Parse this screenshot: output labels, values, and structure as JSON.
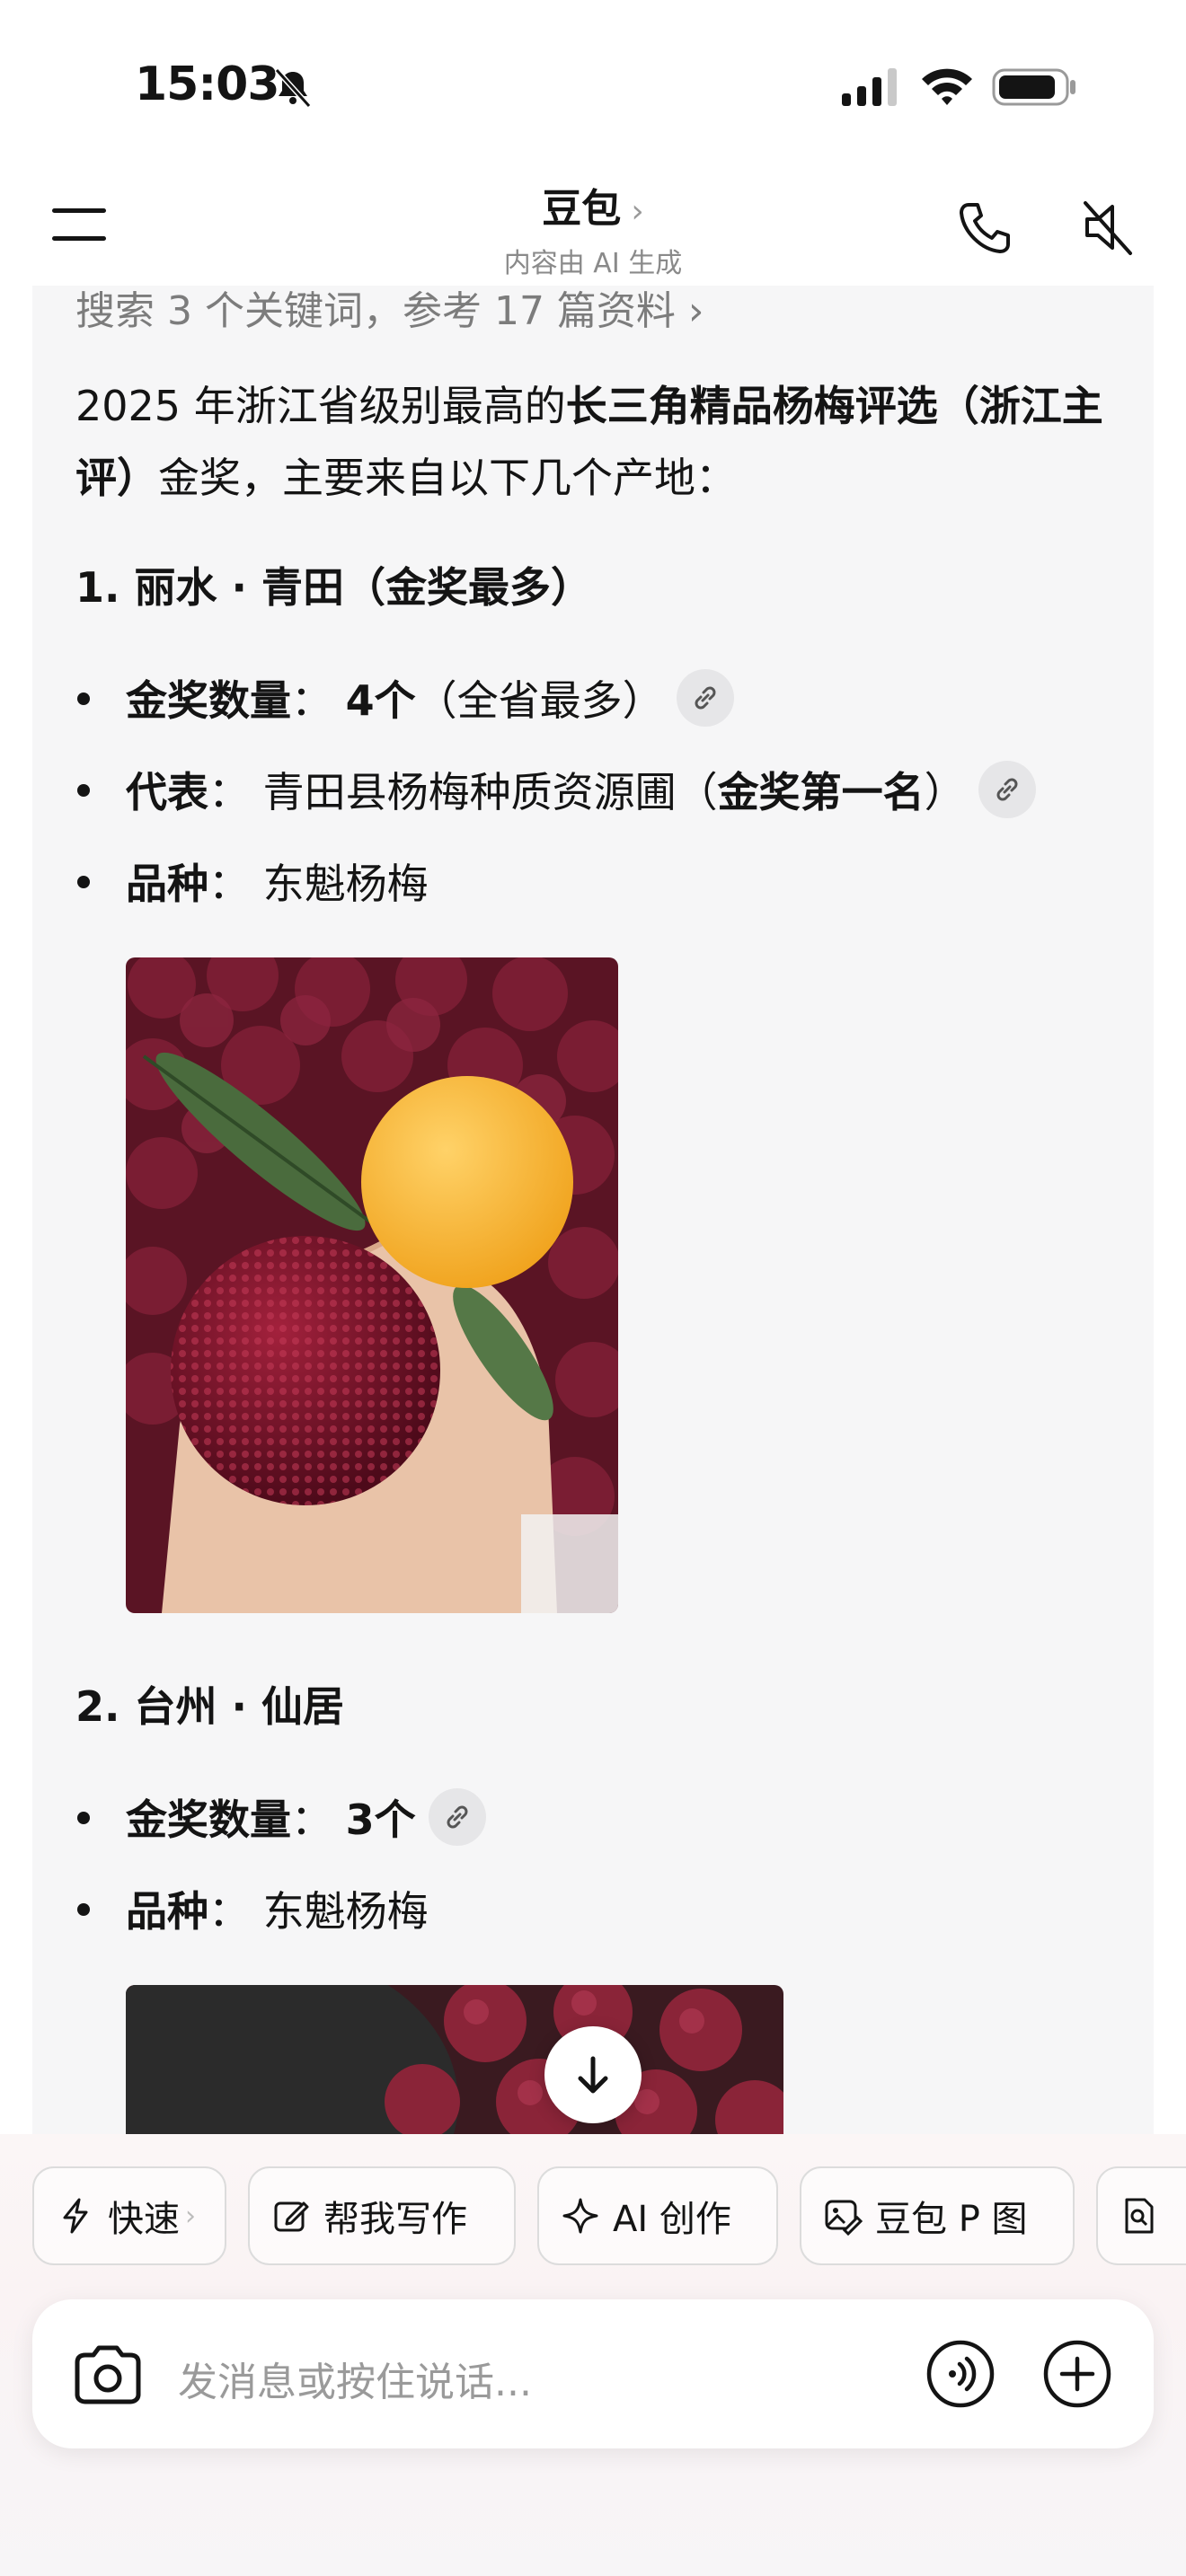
{
  "status_bar": {
    "time": "15:03",
    "icons": [
      "bell-off-icon",
      "signal-icon",
      "wifi-icon",
      "battery-icon"
    ]
  },
  "header": {
    "title": "豆包",
    "title_chevron": "›",
    "subtitle": "内容由 AI 生成",
    "icons": [
      "menu-icon",
      "phone-icon",
      "speaker-mute-icon"
    ]
  },
  "message": {
    "search_ref": "搜索 3 个关键词，参考 17 篇资料 ›",
    "intro": {
      "p1": "2025 年浙江省级别最高的",
      "b1": "长三角精品杨梅评选（浙江主评）",
      "p2": "金奖，主要来自以下几个产地："
    },
    "section1": {
      "heading": "1. 丽水 · 青田（金奖最多）",
      "items": [
        {
          "label": "金奖数量",
          "sep": "：",
          "value_bold": "4个",
          "value_plain": "（全省最多）",
          "has_link": true
        },
        {
          "label": "代表",
          "sep": "：",
          "value_plain": "青田县杨梅种质资源圃（",
          "value_bold": "金奖第一名",
          "value_tail": "）",
          "has_link": true
        },
        {
          "label": "品种",
          "sep": "：",
          "value_plain": "东魁杨梅",
          "has_link": false
        }
      ]
    },
    "section2": {
      "heading": "2. 台州 · 仙居",
      "items": [
        {
          "label": "金奖数量",
          "sep": "：",
          "value_bold": "3个",
          "has_link": true
        },
        {
          "label": "品种",
          "sep": "：",
          "value_plain": "东魁杨梅",
          "has_link": false
        }
      ]
    }
  },
  "quick_actions": [
    {
      "label": "快速",
      "icon": "lightning-icon",
      "chevron": "›"
    },
    {
      "label": "帮我写作",
      "icon": "edit-icon"
    },
    {
      "label": "AI 创作",
      "icon": "sparkle-icon"
    },
    {
      "label": "豆包 P 图",
      "icon": "image-edit-icon"
    }
  ],
  "composer": {
    "placeholder": "发消息或按住说话...",
    "icons": [
      "camera-icon",
      "voice-wave-icon",
      "plus-icon"
    ]
  },
  "colors": {
    "card_bg": "#f6f6f7",
    "muted_text": "#7c7c7c",
    "chip_border": "#dcdcdc"
  }
}
